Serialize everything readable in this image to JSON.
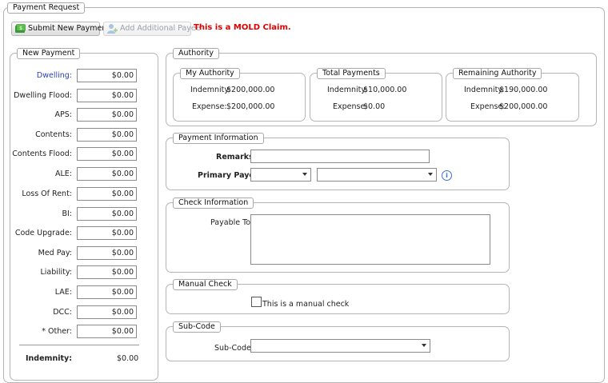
{
  "page": {
    "title": "Payment Request"
  },
  "toolbar": {
    "submit_label": "Submit New Payment",
    "add_payee_label": "Add Additional Payee",
    "claim_message": "This is a MOLD Claim."
  },
  "colors": {
    "claim_message": "#e00000",
    "dwelling_label": "#2a3fb3"
  },
  "new_payment": {
    "title": "New Payment",
    "rows": [
      {
        "label": "Dwelling:",
        "value": "$0.00"
      },
      {
        "label": "Dwelling Flood:",
        "value": "$0.00"
      },
      {
        "label": "APS:",
        "value": "$0.00"
      },
      {
        "label": "Contents:",
        "value": "$0.00"
      },
      {
        "label": "Contents Flood:",
        "value": "$0.00"
      },
      {
        "label": "ALE:",
        "value": "$0.00"
      },
      {
        "label": "Loss Of Rent:",
        "value": "$0.00"
      },
      {
        "label": "BI:",
        "value": "$0.00"
      },
      {
        "label": "Code Upgrade:",
        "value": "$0.00"
      },
      {
        "label": "Med Pay:",
        "value": "$0.00"
      },
      {
        "label": "Liability:",
        "value": "$0.00"
      },
      {
        "label": "LAE:",
        "value": "$0.00"
      },
      {
        "label": "DCC:",
        "value": "$0.00"
      },
      {
        "label": "* Other:",
        "value": "$0.00"
      }
    ],
    "total_label": "Indemnity:",
    "total_value": "$0.00"
  },
  "authority": {
    "title": "Authority",
    "my": {
      "title": "My Authority",
      "indemnity_label": "Indemnity:",
      "indemnity": "$200,000.00",
      "expense_label": "Expense:",
      "expense": "$200,000.00"
    },
    "total": {
      "title": "Total Payments",
      "indemnity_label": "Indemnity:",
      "indemnity": "$10,000.00",
      "expense_label": "Expense:",
      "expense": "$0.00"
    },
    "remaining": {
      "title": "Remaining Authority",
      "indemnity_label": "Indemnity:",
      "indemnity": "$190,000.00",
      "expense_label": "Expense:",
      "expense": "$200,000.00"
    }
  },
  "payment_info": {
    "title": "Payment Information",
    "remarks_label": "Remarks:",
    "remarks_value": "",
    "payee_label": "Primary Payee:",
    "payee_type": "",
    "payee_name": ""
  },
  "check_info": {
    "title": "Check Information",
    "payable_label": "Payable To:",
    "payable_value": ""
  },
  "manual_check": {
    "title": "Manual Check",
    "checkbox_label": "This is a manual check",
    "checked": false
  },
  "subcode": {
    "title": "Sub-Code",
    "label": "Sub-Code:",
    "value": ""
  },
  "icons": {
    "submit": "money-icon",
    "add_payee": "add-person-icon",
    "info": "info-icon"
  }
}
